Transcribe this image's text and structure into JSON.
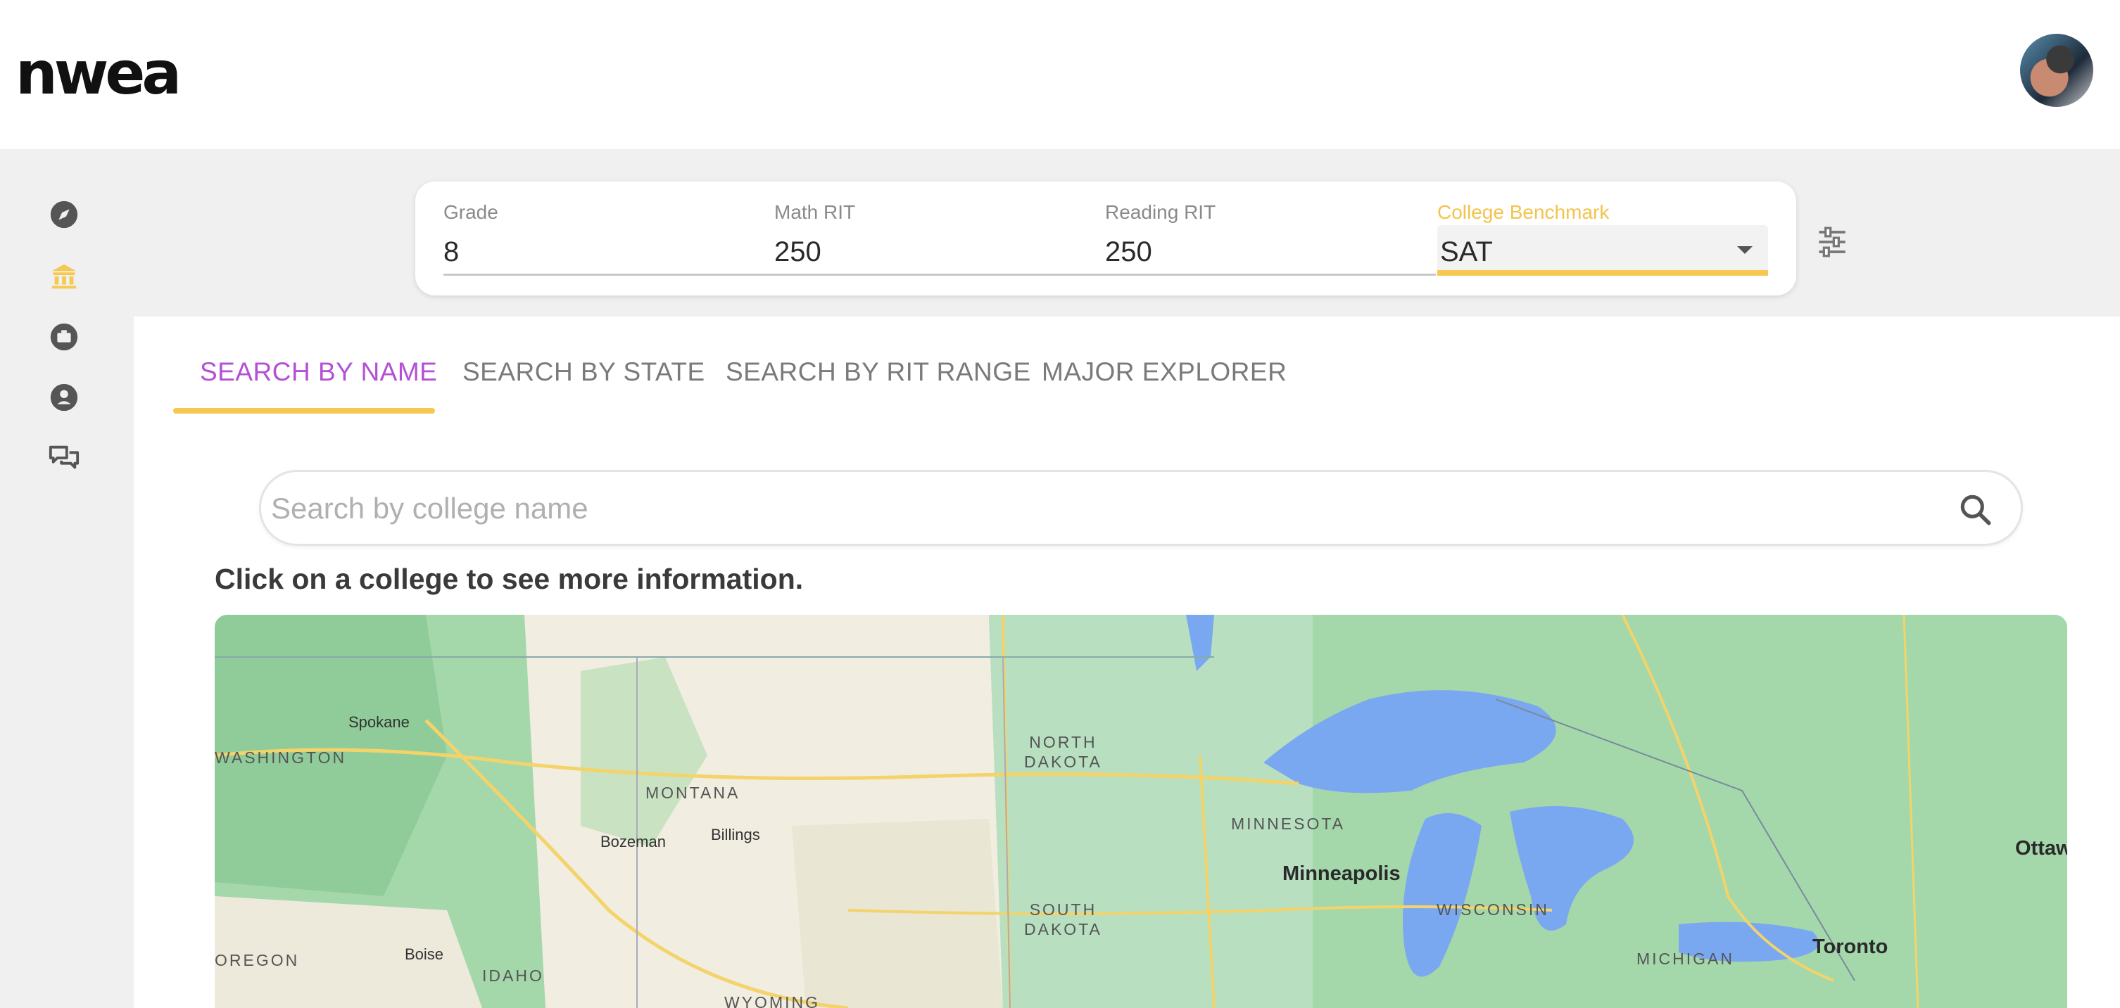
{
  "header": {
    "logo_text": "nwea"
  },
  "filters": {
    "grade": {
      "label": "Grade",
      "value": "8"
    },
    "math_rit": {
      "label": "Math RIT",
      "value": "250"
    },
    "reading_rit": {
      "label": "Reading RIT",
      "value": "250"
    },
    "college_benchmark": {
      "label": "College Benchmark",
      "value": "SAT"
    }
  },
  "tabs": [
    {
      "label": "SEARCH BY NAME",
      "active": true
    },
    {
      "label": "SEARCH BY STATE",
      "active": false
    },
    {
      "label": "SEARCH BY RIT RANGE",
      "active": false
    },
    {
      "label": "MAJOR EXPLORER",
      "active": false
    }
  ],
  "search": {
    "placeholder": "Search by college name",
    "value": ""
  },
  "hint_text": "Click on a college to see more information.",
  "map": {
    "states": [
      "WASHINGTON",
      "MONTANA",
      "NORTH DAKOTA",
      "SOUTH DAKOTA",
      "MINNESOTA",
      "WISCONSIN",
      "MICHIGAN",
      "OREGON",
      "IDAHO",
      "WYOMING"
    ],
    "state_line_breaks": {
      "north_dakota": [
        "NORTH",
        "DAKOTA"
      ],
      "south_dakota": [
        "SOUTH",
        "DAKOTA"
      ]
    },
    "cities": [
      "Spokane",
      "Bozeman",
      "Billings",
      "Minneapolis",
      "Toronto",
      "Ottawa",
      "Boise"
    ]
  },
  "colors": {
    "accent_purple": "#b44fd6",
    "accent_yellow": "#f6c84f",
    "map_land": "#9fd6a8",
    "map_water": "#7aa8f0"
  }
}
